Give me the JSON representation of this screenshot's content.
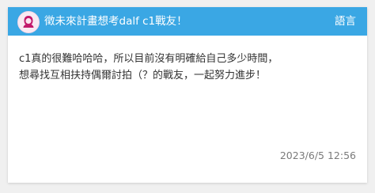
{
  "header": {
    "title": "徵未來計畫想考dalf c1戰友！",
    "language_label": "語言",
    "avatar_icon": "user-avatar-icon",
    "background_color": "#3aa7e4"
  },
  "post": {
    "body_lines": [
      "c1真的很難哈哈哈，所以目前沒有明確給自己多少時間，",
      "想尋找互相扶持偶爾討拍（？的戰友，一起努力進步！"
    ],
    "date": "2023/6/5 12:56"
  }
}
